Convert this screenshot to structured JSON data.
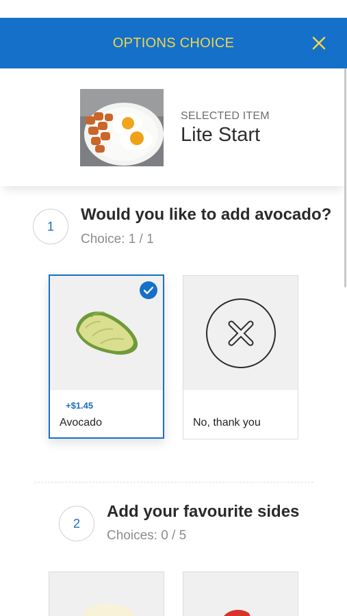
{
  "header": {
    "title": "OPTIONS CHOICE",
    "close_icon": "close-icon"
  },
  "selected_item": {
    "caption": "SELECTED ITEM",
    "name": "Lite Start",
    "photo": "breakfast-plate-image"
  },
  "steps": [
    {
      "number": "1",
      "question": "Would you like to add avocado?",
      "choices": "Choice: 1 / 1",
      "options": [
        {
          "label": "Avocado",
          "price": "+$1.45",
          "selected": true,
          "image": "avocado-image"
        },
        {
          "label": "No, thank you",
          "price": "",
          "selected": false,
          "image": "x-circle-icon"
        }
      ]
    },
    {
      "number": "2",
      "question": "Add your favourite sides",
      "choices": "Choices: 0 / 5",
      "options": [
        {
          "label": "",
          "image": "side-item-image"
        },
        {
          "label": "",
          "image": "side-item-image"
        }
      ]
    }
  ],
  "colors": {
    "header_bg": "#1570c9",
    "header_text": "#f2d64b",
    "accent": "#1b6cc2"
  }
}
